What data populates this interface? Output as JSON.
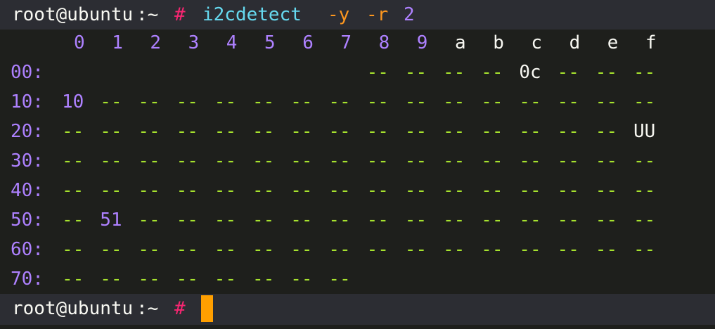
{
  "colors": {
    "background": "#1e1f1c",
    "prompt_line_background": "#2c2d33",
    "text": "#f8f8f2",
    "prompt_symbol": "#f92672",
    "command": "#66d9ef",
    "flag": "#fd971f",
    "number": "#ae81ff",
    "empty_cell": "#a6e22e",
    "cursor": "#ff9f00"
  },
  "prompt": {
    "user_host": "root@ubuntu",
    "path": ":~",
    "symbol": "#"
  },
  "command": {
    "program": "i2cdetect",
    "flag_y": "-y",
    "flag_r": "-r",
    "bus": "2"
  },
  "header_columns": [
    "0",
    "1",
    "2",
    "3",
    "4",
    "5",
    "6",
    "7",
    "8",
    "9",
    "a",
    "b",
    "c",
    "d",
    "e",
    "f"
  ],
  "rows": [
    {
      "label": "00:",
      "cells": [
        "",
        "",
        "",
        "",
        "",
        "",
        "",
        "",
        "--",
        "--",
        "--",
        "--",
        "0c",
        "--",
        "--",
        "--"
      ]
    },
    {
      "label": "10:",
      "cells": [
        "10",
        "--",
        "--",
        "--",
        "--",
        "--",
        "--",
        "--",
        "--",
        "--",
        "--",
        "--",
        "--",
        "--",
        "--",
        "--"
      ]
    },
    {
      "label": "20:",
      "cells": [
        "--",
        "--",
        "--",
        "--",
        "--",
        "--",
        "--",
        "--",
        "--",
        "--",
        "--",
        "--",
        "--",
        "--",
        "--",
        "UU"
      ]
    },
    {
      "label": "30:",
      "cells": [
        "--",
        "--",
        "--",
        "--",
        "--",
        "--",
        "--",
        "--",
        "--",
        "--",
        "--",
        "--",
        "--",
        "--",
        "--",
        "--"
      ]
    },
    {
      "label": "40:",
      "cells": [
        "--",
        "--",
        "--",
        "--",
        "--",
        "--",
        "--",
        "--",
        "--",
        "--",
        "--",
        "--",
        "--",
        "--",
        "--",
        "--"
      ]
    },
    {
      "label": "50:",
      "cells": [
        "--",
        "51",
        "--",
        "--",
        "--",
        "--",
        "--",
        "--",
        "--",
        "--",
        "--",
        "--",
        "--",
        "--",
        "--",
        "--"
      ]
    },
    {
      "label": "60:",
      "cells": [
        "--",
        "--",
        "--",
        "--",
        "--",
        "--",
        "--",
        "--",
        "--",
        "--",
        "--",
        "--",
        "--",
        "--",
        "--",
        "--"
      ]
    },
    {
      "label": "70:",
      "cells": [
        "--",
        "--",
        "--",
        "--",
        "--",
        "--",
        "--",
        "--",
        "",
        "",
        "",
        "",
        "",
        "",
        "",
        ""
      ]
    }
  ],
  "cursor_icon": "block-cursor-icon"
}
